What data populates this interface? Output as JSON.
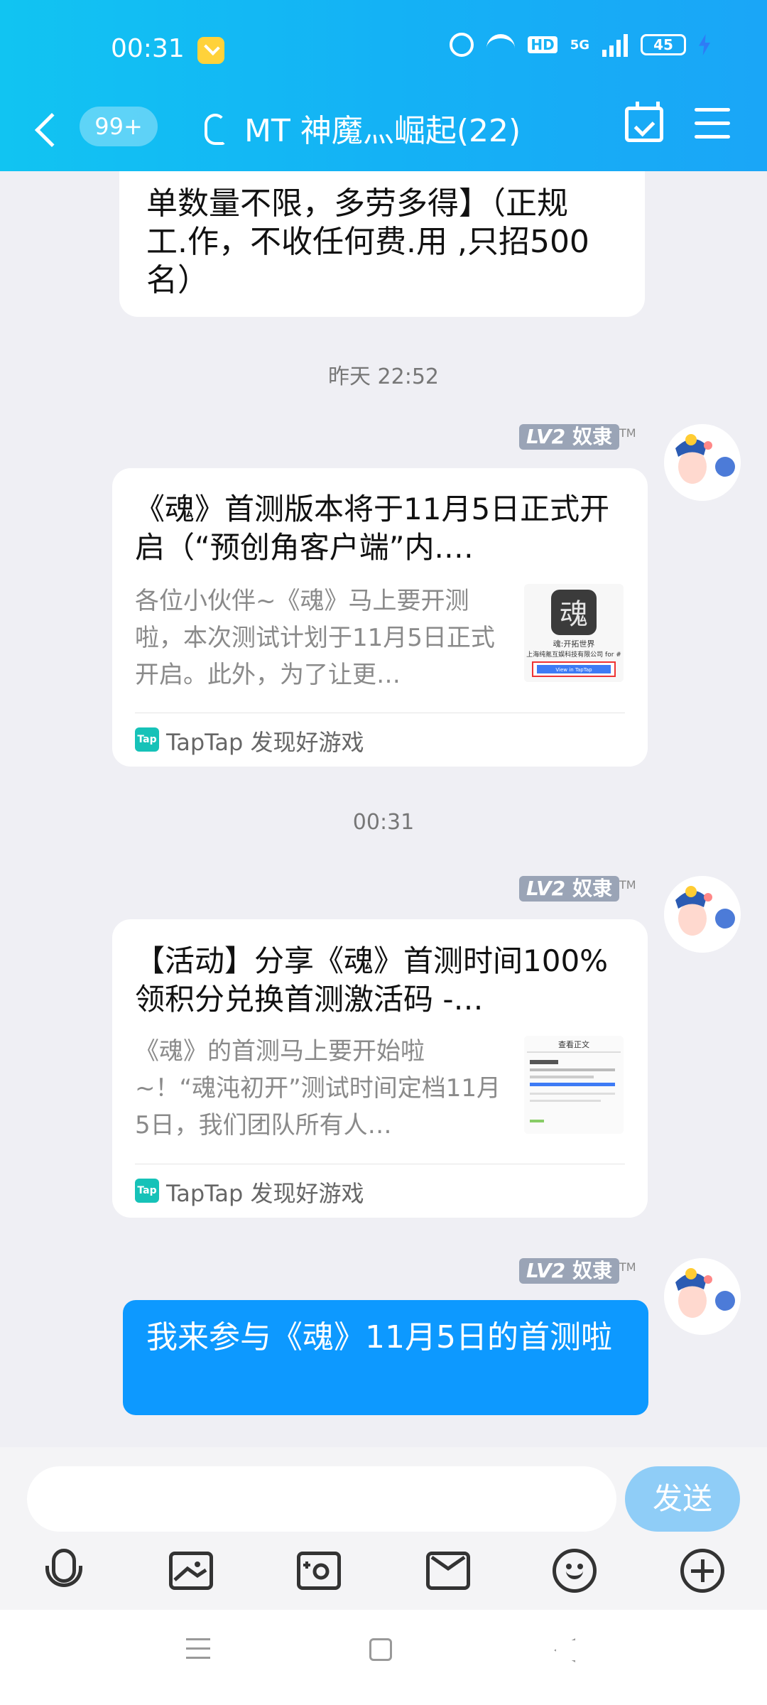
{
  "status_bar": {
    "time": "00:31",
    "hd_label": "HD",
    "network_label": "5G",
    "battery": "45"
  },
  "header": {
    "unread_badge": "99+",
    "title": "MT  神魔灬崛起(22)"
  },
  "chat": {
    "previous_message": {
      "text": "单数量不限，多劳多得】（正规工.作，不收任何费.用 ,只招500名）"
    },
    "timestamp_1": "昨天 22:52",
    "card_1": {
      "sender_level": "LV2",
      "sender_title": "奴隶",
      "tm": "TM",
      "title": "《魂》首测版本将于11月5日正式开启（“预创角客户端”内.…",
      "description": "各位小伙伴~《魂》马上要开测啦，本次测试计划于11月5日正式开启。此外，为了让更…",
      "source": "TapTap 发现好游戏",
      "source_logo": "Tap",
      "thumbnail": {
        "caption_1": "魂:开拓世界",
        "caption_2": "上海纯氪互娱科技有限公司 for #",
        "button": "View in TapTap"
      }
    },
    "timestamp_2": "00:31",
    "card_2": {
      "sender_level": "LV2",
      "sender_title": "奴隶",
      "tm": "TM",
      "title": "【活动】分享《魂》首测时间100%领积分兑换首测激活码 -…",
      "description": "《魂》的首测马上要开始啦~！“魂沌初开”测试时间定档11月5日，我们团队所有人…",
      "source": "TapTap 发现好游戏",
      "source_logo": "Tap",
      "thumbnail": {
        "caption_1": "查看正文"
      }
    },
    "message_3": {
      "sender_level": "LV2",
      "sender_title": "奴隶",
      "tm": "TM",
      "text": "我来参与《魂》11月5日的首测啦"
    }
  },
  "input": {
    "value": "",
    "send_label": "发送"
  },
  "toolbar": {
    "items": [
      "voice-icon",
      "image-icon",
      "camera-icon",
      "red-packet-icon",
      "emoji-icon",
      "plus-icon"
    ]
  },
  "colors": {
    "header": "#14b2f5",
    "accent": "#0d99ff",
    "send_button": "#8fcdf7",
    "background": "#efeff4"
  }
}
